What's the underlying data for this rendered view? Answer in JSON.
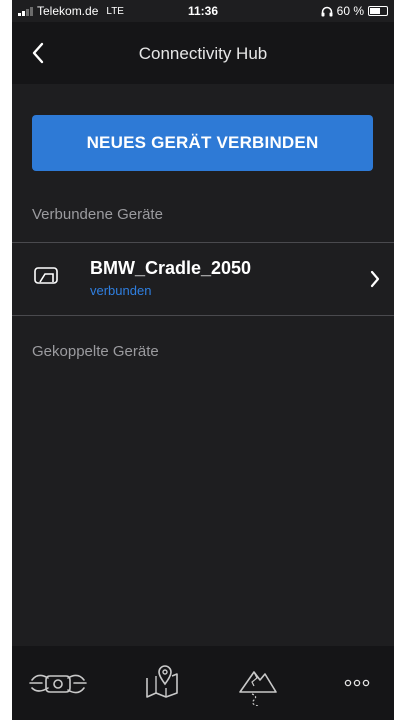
{
  "status_bar": {
    "carrier": "Telekom.de",
    "network": "LTE",
    "time": "11:36",
    "battery_text": "60 %",
    "battery_level": 0.6
  },
  "nav": {
    "title": "Connectivity Hub",
    "back_icon": "chevron-left-icon"
  },
  "connect_button_label": "NEUES GERÄT VERBINDEN",
  "sections": {
    "connected": "Verbundene Geräte",
    "paired": "Gekoppelte Geräte"
  },
  "devices": [
    {
      "name": "BMW_Cradle_2050",
      "status": "verbunden",
      "icon": "cradle-icon"
    }
  ],
  "tab_bar": [
    {
      "icon": "motorcycle-icon"
    },
    {
      "icon": "map-icon"
    },
    {
      "icon": "mountain-route-icon"
    },
    {
      "icon": "more-icon"
    }
  ],
  "colors": {
    "background": "#1e1e20",
    "accent": "#2e7ad6",
    "status_text": "#2f7fe0"
  }
}
